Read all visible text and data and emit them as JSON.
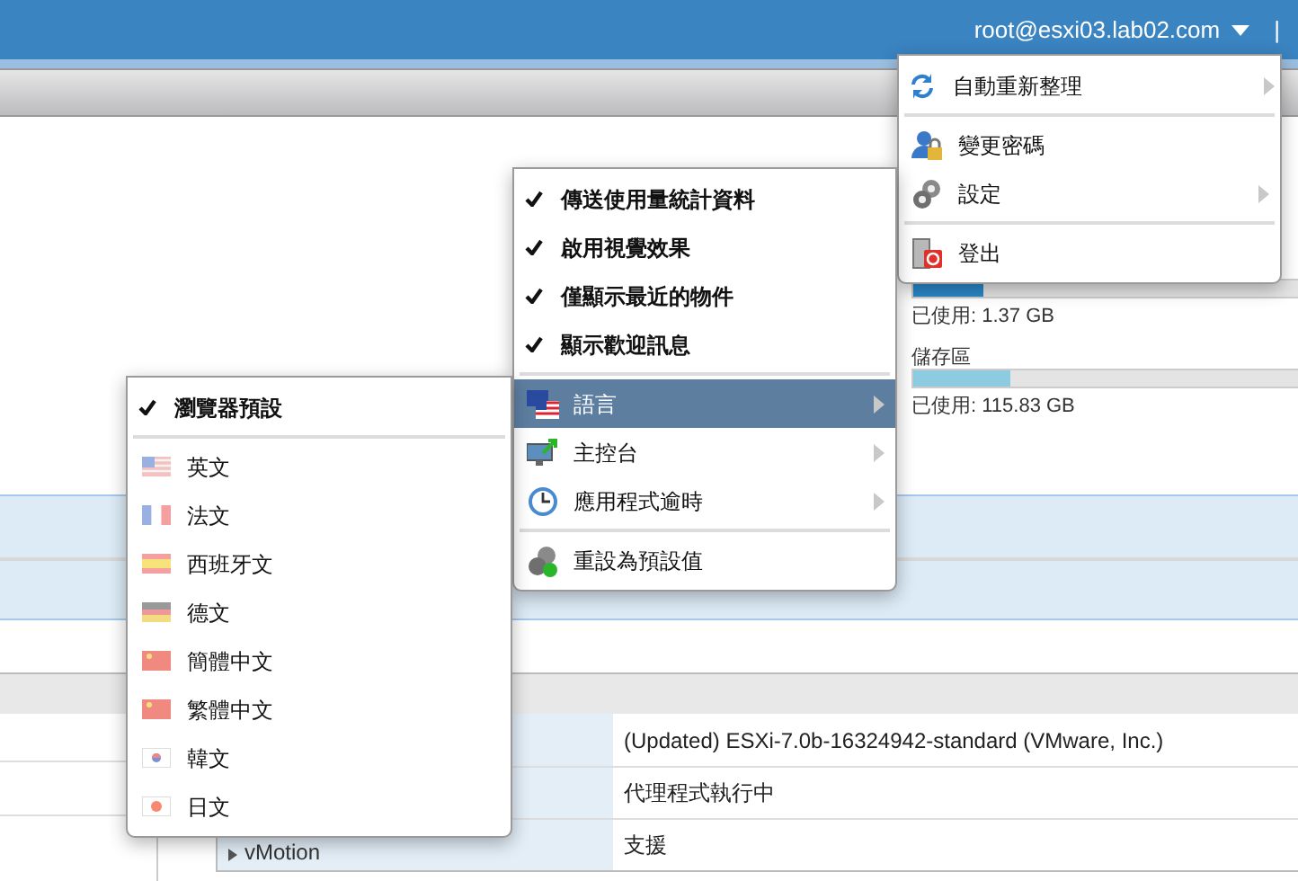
{
  "header": {
    "user": "root@esxi03.lab02.com",
    "separator": "|"
  },
  "storage": [
    {
      "level": 0.15,
      "used": "已使用: 1.37 GB"
    },
    {
      "label": "儲存區",
      "level": 0.21,
      "used": "已使用: 115.83 GB"
    }
  ],
  "table": {
    "rows": [
      {
        "value": "(Updated) ESXi-7.0b-16324942-standard (VMware, Inc.)"
      },
      {
        "value": "代理程式執行中"
      },
      {
        "key": "vMotion",
        "value": "支援"
      }
    ]
  },
  "user_menu": {
    "groups": [
      [
        {
          "label": "自動重新整理",
          "has_submenu": true
        }
      ],
      [
        {
          "label": "變更密碼",
          "has_submenu": false
        },
        {
          "label": "設定",
          "has_submenu": true
        }
      ],
      [
        {
          "label": "登出",
          "has_submenu": false
        }
      ]
    ]
  },
  "settings_menu": {
    "groups": [
      [
        {
          "kind": "check",
          "label": "傳送使用量統計資料",
          "checked": true
        },
        {
          "kind": "check",
          "label": "啟用視覺效果",
          "checked": true
        },
        {
          "kind": "check",
          "label": "僅顯示最近的物件",
          "checked": true
        },
        {
          "kind": "check",
          "label": "顯示歡迎訊息",
          "checked": true
        }
      ],
      [
        {
          "kind": "icon",
          "label": "語言",
          "has_submenu": true,
          "selected": true
        },
        {
          "kind": "icon",
          "label": "主控台",
          "has_submenu": true,
          "selected": false
        },
        {
          "kind": "icon",
          "label": "應用程式逾時",
          "has_submenu": true,
          "selected": false
        }
      ],
      [
        {
          "kind": "icon",
          "label": "重設為預設值",
          "has_submenu": false,
          "selected": false
        }
      ]
    ]
  },
  "language_menu": {
    "groups": [
      [
        {
          "kind": "check",
          "label": "瀏覽器預設",
          "checked": true
        }
      ],
      [
        {
          "kind": "flag",
          "label": "英文"
        },
        {
          "kind": "flag",
          "label": "法文"
        },
        {
          "kind": "flag",
          "label": "西班牙文"
        },
        {
          "kind": "flag",
          "label": "德文"
        },
        {
          "kind": "flag",
          "label": "簡體中文"
        },
        {
          "kind": "flag",
          "label": "繁體中文"
        },
        {
          "kind": "flag",
          "label": "韓文"
        },
        {
          "kind": "flag",
          "label": "日文"
        }
      ]
    ]
  }
}
